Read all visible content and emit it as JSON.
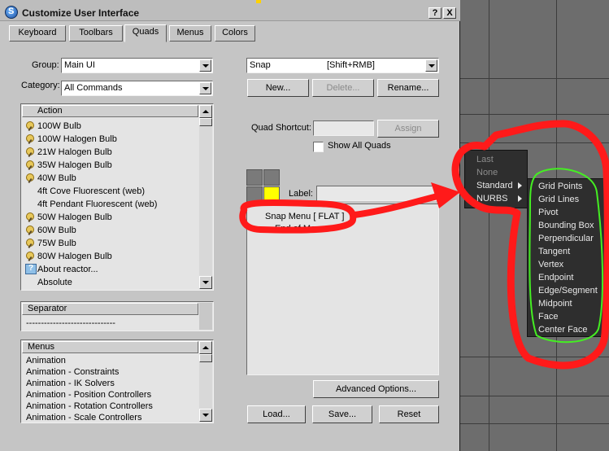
{
  "window": {
    "title": "Customize User Interface",
    "help_button": "?",
    "close_button": "X"
  },
  "tabs": [
    {
      "label": "Keyboard",
      "active": false
    },
    {
      "label": "Toolbars",
      "active": false
    },
    {
      "label": "Quads",
      "active": true
    },
    {
      "label": "Menus",
      "active": false
    },
    {
      "label": "Colors",
      "active": false
    }
  ],
  "left": {
    "group_label": "Group:",
    "group_value": "Main UI",
    "category_label": "Category:",
    "category_value": "All Commands",
    "actions": {
      "header": "Action",
      "items": [
        {
          "label": "100W Bulb",
          "icon": "bulb-icon"
        },
        {
          "label": "100W Halogen Bulb",
          "icon": "bulb-icon"
        },
        {
          "label": "21W Halogen Bulb",
          "icon": "bulb-icon"
        },
        {
          "label": "35W Halogen Bulb",
          "icon": "bulb-icon"
        },
        {
          "label": "40W Bulb",
          "icon": "bulb-icon"
        },
        {
          "label": "4ft Cove Fluorescent (web)",
          "icon": ""
        },
        {
          "label": "4ft Pendant Fluorescent (web)",
          "icon": ""
        },
        {
          "label": "50W Halogen Bulb",
          "icon": "bulb-icon"
        },
        {
          "label": "60W Bulb",
          "icon": "bulb-icon"
        },
        {
          "label": "75W Bulb",
          "icon": "bulb-icon"
        },
        {
          "label": "80W Halogen Bulb",
          "icon": "bulb-icon"
        },
        {
          "label": "About reactor...",
          "icon": "help-icon"
        },
        {
          "label": "Absolute",
          "icon": ""
        }
      ]
    },
    "separator": {
      "header": "Separator",
      "item": "------------------------------"
    },
    "menus": {
      "header": "Menus",
      "items": [
        "Animation",
        "Animation - Constraints",
        "Animation - IK Solvers",
        "Animation - Position Controllers",
        "Animation - Rotation Controllers",
        "Animation - Scale Controllers"
      ]
    }
  },
  "right": {
    "quad_select_name": "Snap",
    "quad_select_shortcut": "[Shift+RMB]",
    "buttons": {
      "new": "New...",
      "delete": "Delete...",
      "rename": "Rename...",
      "assign": "Assign",
      "advanced": "Advanced Options...",
      "load": "Load...",
      "save": "Save...",
      "reset": "Reset"
    },
    "quad_shortcut_label": "Quad Shortcut:",
    "show_all_quads_label": "Show All Quads",
    "label_label": "Label:",
    "tree": [
      "Snap Menu [ FLAT ]",
      "End of Menu"
    ]
  },
  "quad_menu": {
    "left_items": [
      {
        "label": "Last",
        "dim": true
      },
      {
        "label": "None",
        "dim": true
      },
      {
        "label": "Standard",
        "dim": false,
        "submenu": true
      },
      {
        "label": "NURBS",
        "dim": false,
        "submenu": true
      }
    ],
    "submenu_items": [
      "Grid Points",
      "Grid Lines",
      "Pivot",
      "Bounding Box",
      "Perpendicular",
      "Tangent",
      "Vertex",
      "Endpoint",
      "Edge/Segment",
      "Midpoint",
      "Face",
      "Center Face"
    ]
  },
  "colors": {
    "annotation_red": "#ff1a1a",
    "annotation_green": "#44ee22",
    "quad_highlight": "#ffff00"
  }
}
